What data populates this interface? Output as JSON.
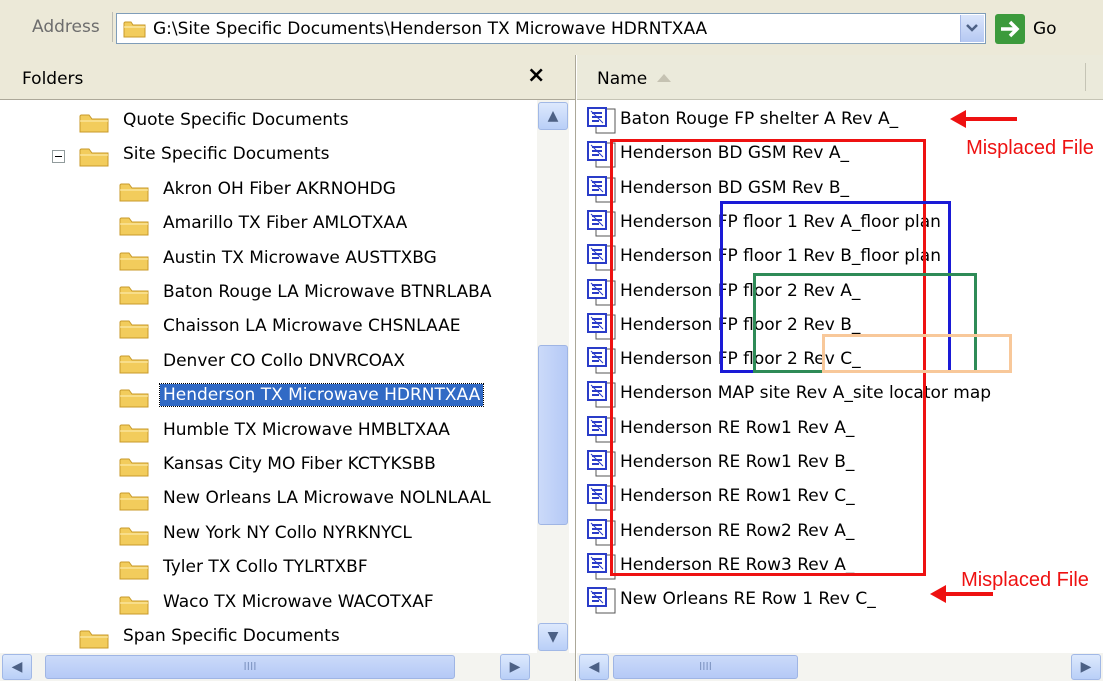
{
  "address_bar": {
    "label": "Address",
    "path": "G:\\Site Specific Documents\\Henderson TX Microwave HDRNTXAA",
    "go_label": "Go"
  },
  "folders_pane": {
    "title": "Folders",
    "close_glyph": "×",
    "items": [
      {
        "label": "Quote Specific Documents"
      },
      {
        "label": "Site Specific Documents"
      },
      {
        "label": "Akron OH Fiber AKRNOHDG"
      },
      {
        "label": "Amarillo TX Fiber AMLOTXAA"
      },
      {
        "label": "Austin TX Microwave AUSTTXBG"
      },
      {
        "label": "Baton Rouge LA Microwave BTNRLABA"
      },
      {
        "label": "Chaisson LA Microwave CHSNLAAE"
      },
      {
        "label": "Denver CO Collo DNVRCOAX"
      },
      {
        "label": "Henderson TX Microwave HDRNTXAA"
      },
      {
        "label": "Humble TX Microwave HMBLTXAA"
      },
      {
        "label": "Kansas City MO Fiber KCTYKSBB"
      },
      {
        "label": "New Orleans LA Microwave NOLNLAAL"
      },
      {
        "label": "New York NY Collo NYRKNYCL"
      },
      {
        "label": "Tyler TX Collo TYLRTXBF"
      },
      {
        "label": "Waco TX Microwave WACOTXAF"
      },
      {
        "label": "Span Specific Documents"
      }
    ],
    "selected_label": "Henderson TX Microwave HDRNTXAA"
  },
  "file_list": {
    "column_name": "Name",
    "files": [
      {
        "label": "Baton Rouge FP shelter A Rev A_"
      },
      {
        "label": "Henderson BD GSM Rev A_"
      },
      {
        "label": "Henderson BD GSM Rev B_"
      },
      {
        "label": "Henderson FP floor 1 Rev A_floor plan"
      },
      {
        "label": "Henderson FP floor 1 Rev B_floor plan"
      },
      {
        "label": "Henderson FP floor 2 Rev A_"
      },
      {
        "label": "Henderson FP floor 2 Rev B_"
      },
      {
        "label": "Henderson FP floor 2 Rev C_"
      },
      {
        "label": "Henderson MAP site Rev A_site locator map"
      },
      {
        "label": "Henderson RE Row1 Rev A_"
      },
      {
        "label": "Henderson RE Row1 Rev B_"
      },
      {
        "label": "Henderson RE Row1 Rev C_"
      },
      {
        "label": "Henderson RE Row2 Rev A_"
      },
      {
        "label": "Henderson RE Row3 Rev A_"
      },
      {
        "label": "New Orleans RE Row 1 Rev C_"
      }
    ]
  },
  "annotations": {
    "note_top": "Misplaced File",
    "note_bottom": "Misplaced File",
    "colors": {
      "red": "#ee1111",
      "blue": "#1a1ad6",
      "green": "#2e8b57",
      "orange": "#f8c89a"
    }
  },
  "colors": {
    "chrome": "#ece9d8",
    "selection": "#316ac5",
    "folder": "#f2cc5c"
  }
}
